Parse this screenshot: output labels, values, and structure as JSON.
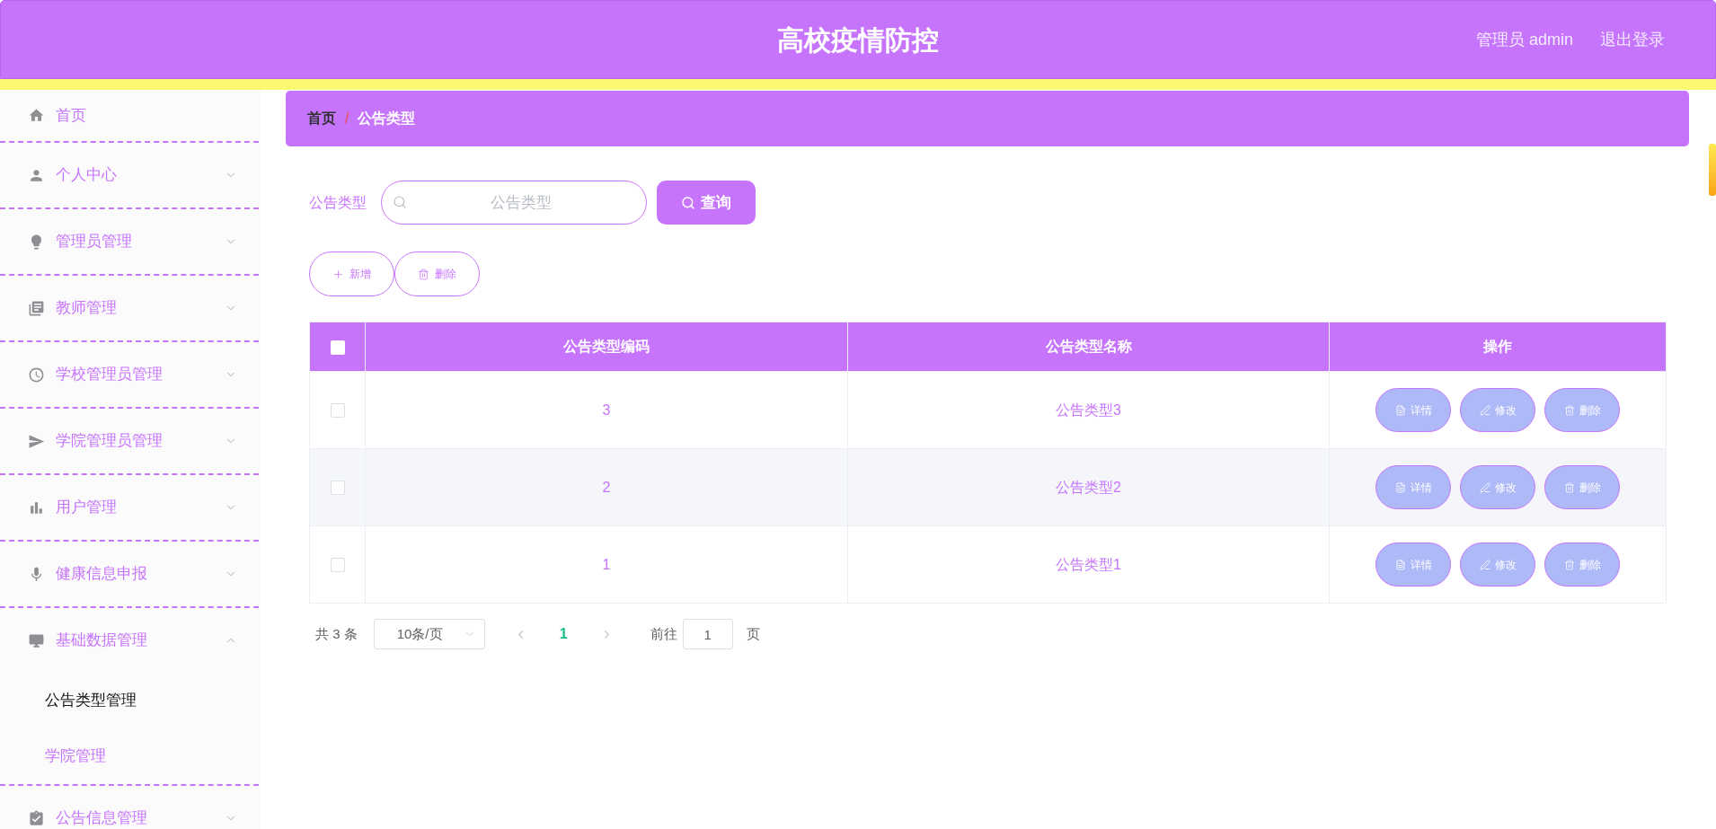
{
  "header": {
    "title": "高校疫情防控",
    "user": "管理员 admin",
    "logout": "退出登录"
  },
  "sidebar": {
    "items": [
      {
        "label": "首页",
        "kind": "link"
      },
      {
        "label": "个人中心",
        "kind": "menu",
        "expanded": false
      },
      {
        "label": "管理员管理",
        "kind": "menu",
        "expanded": false
      },
      {
        "label": "教师管理",
        "kind": "menu",
        "expanded": false
      },
      {
        "label": "学校管理员管理",
        "kind": "menu",
        "expanded": false
      },
      {
        "label": "学院管理员管理",
        "kind": "menu",
        "expanded": false
      },
      {
        "label": "用户管理",
        "kind": "menu",
        "expanded": false
      },
      {
        "label": "健康信息申报",
        "kind": "menu",
        "expanded": false
      },
      {
        "label": "基础数据管理",
        "kind": "menu",
        "expanded": true,
        "children": [
          {
            "label": "公告类型管理",
            "selected": true
          },
          {
            "label": "学院管理",
            "selected": false
          }
        ]
      },
      {
        "label": "公告信息管理",
        "kind": "menu",
        "expanded": false
      }
    ]
  },
  "breadcrumb": {
    "items": [
      "首页",
      "公告类型"
    ],
    "separator": "/"
  },
  "search": {
    "label": "公告类型",
    "placeholder": "公告类型",
    "button": "查询"
  },
  "toolbar": [
    {
      "label": "新增",
      "kind": "add"
    },
    {
      "label": "删除",
      "kind": "delete"
    }
  ],
  "table": {
    "header_checkbox": {
      "checked": false
    },
    "columns": [
      "公告类型编码",
      "公告类型名称",
      "操作"
    ],
    "rows": [
      {
        "selected": false,
        "cells": [
          "3",
          "公告类型3"
        ],
        "actions": [
          {
            "label": "详情",
            "kind": "detail"
          },
          {
            "label": "修改",
            "kind": "edit"
          },
          {
            "label": "删除",
            "kind": "delete"
          }
        ]
      },
      {
        "selected": false,
        "cells": [
          "2",
          "公告类型2"
        ],
        "actions": [
          {
            "label": "详情",
            "kind": "detail"
          },
          {
            "label": "修改",
            "kind": "edit"
          },
          {
            "label": "删除",
            "kind": "delete"
          }
        ]
      },
      {
        "selected": false,
        "cells": [
          "1",
          "公告类型1"
        ],
        "actions": [
          {
            "label": "详情",
            "kind": "detail"
          },
          {
            "label": "修改",
            "kind": "edit"
          },
          {
            "label": "删除",
            "kind": "delete"
          }
        ]
      }
    ]
  },
  "pagination": {
    "total": "共 3 条",
    "page_size": "10条/页",
    "prev": {
      "disabled": true
    },
    "pages": [
      {
        "label": "1",
        "selected": true
      }
    ],
    "next": {
      "disabled": true
    },
    "goto_label": "前往",
    "goto_value": "1",
    "goto_suffix": "页"
  }
}
